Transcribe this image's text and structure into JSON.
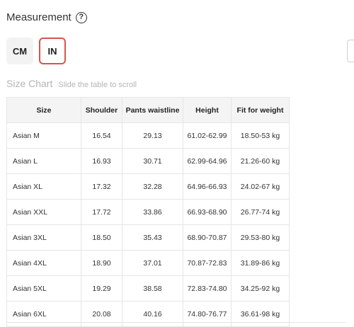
{
  "header": {
    "title": "Measurement",
    "help_icon_glyph": "?"
  },
  "unit_toggle": {
    "cm_label": "CM",
    "in_label": "IN",
    "active": "IN",
    "active_border_color": "#d9534f"
  },
  "size_chart": {
    "title": "Size Chart",
    "hint": "Slide the table to scroll"
  },
  "table": {
    "columns": [
      "Size",
      "Shoulder",
      "Pants waistline",
      "Height",
      "Fit for weight"
    ],
    "rows": [
      [
        "Asian M",
        "16.54",
        "29.13",
        "61.02-62.99",
        "18.50-53 kg"
      ],
      [
        "Asian L",
        "16.93",
        "30.71",
        "62.99-64.96",
        "21.26-60 kg"
      ],
      [
        "Asian XL",
        "17.32",
        "32.28",
        "64.96-66.93",
        "24.02-67 kg"
      ],
      [
        "Asian XXL",
        "17.72",
        "33.86",
        "66.93-68.90",
        "26.77-74 kg"
      ],
      [
        "Asian 3XL",
        "18.50",
        "35.43",
        "68.90-70.87",
        "29.53-80 kg"
      ],
      [
        "Asian 4XL",
        "18.90",
        "37.01",
        "70.87-72.83",
        "31.89-86 kg"
      ],
      [
        "Asian 5XL",
        "19.29",
        "38.58",
        "72.83-74.80",
        "34.25-92 kg"
      ],
      [
        "Asian 6XL",
        "20.08",
        "40.16",
        "74.80-76.77",
        "36.61-98 kg"
      ]
    ]
  }
}
